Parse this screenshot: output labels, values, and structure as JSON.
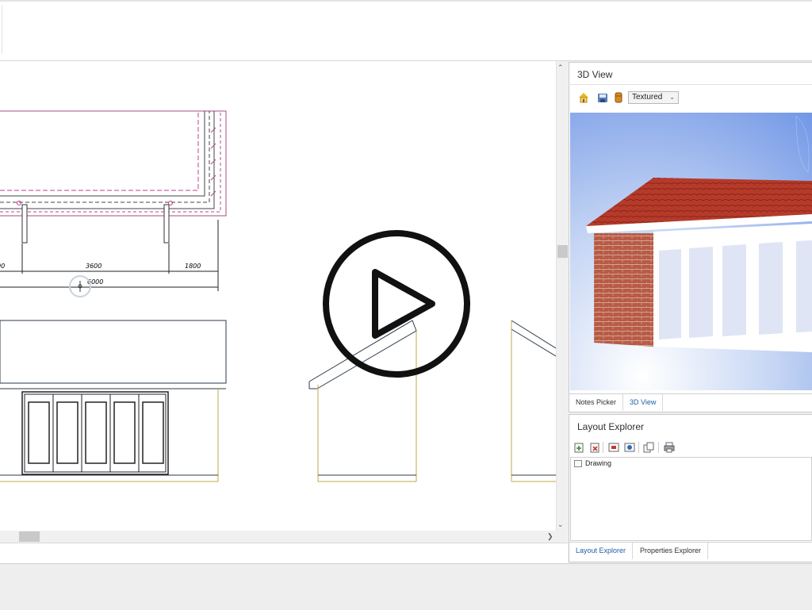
{
  "drawing": {
    "dimensions": {
      "left_partial": "00",
      "middle": "3600",
      "right": "1800",
      "overall": "6000"
    }
  },
  "view3d": {
    "title": "3D View",
    "render_mode": "Textured",
    "toolbar_icons": [
      "house-icon",
      "save-icon",
      "material-icon"
    ]
  },
  "view3d_tabs": [
    {
      "label": "Notes Picker",
      "active": false
    },
    {
      "label": "3D View",
      "active": true
    }
  ],
  "layout_explorer": {
    "title": "Layout Explorer",
    "toolbar_icons": [
      "add-page-icon",
      "delete-page-icon",
      "page-properties-icon",
      "page-settings-icon",
      "duplicate-icon",
      "print-icon"
    ],
    "tree": [
      {
        "label": "Drawing"
      }
    ]
  },
  "bottom_tabs": [
    {
      "label": "Layout Explorer",
      "active": true
    },
    {
      "label": "Properties Explorer",
      "active": false
    }
  ],
  "overlay": {
    "icon": "play-icon"
  },
  "colors": {
    "tab_active": "#1f5fa8",
    "wall_dashed": "#c0408f",
    "roof_tile": "#b53a2a",
    "brick": "#b85a45"
  }
}
